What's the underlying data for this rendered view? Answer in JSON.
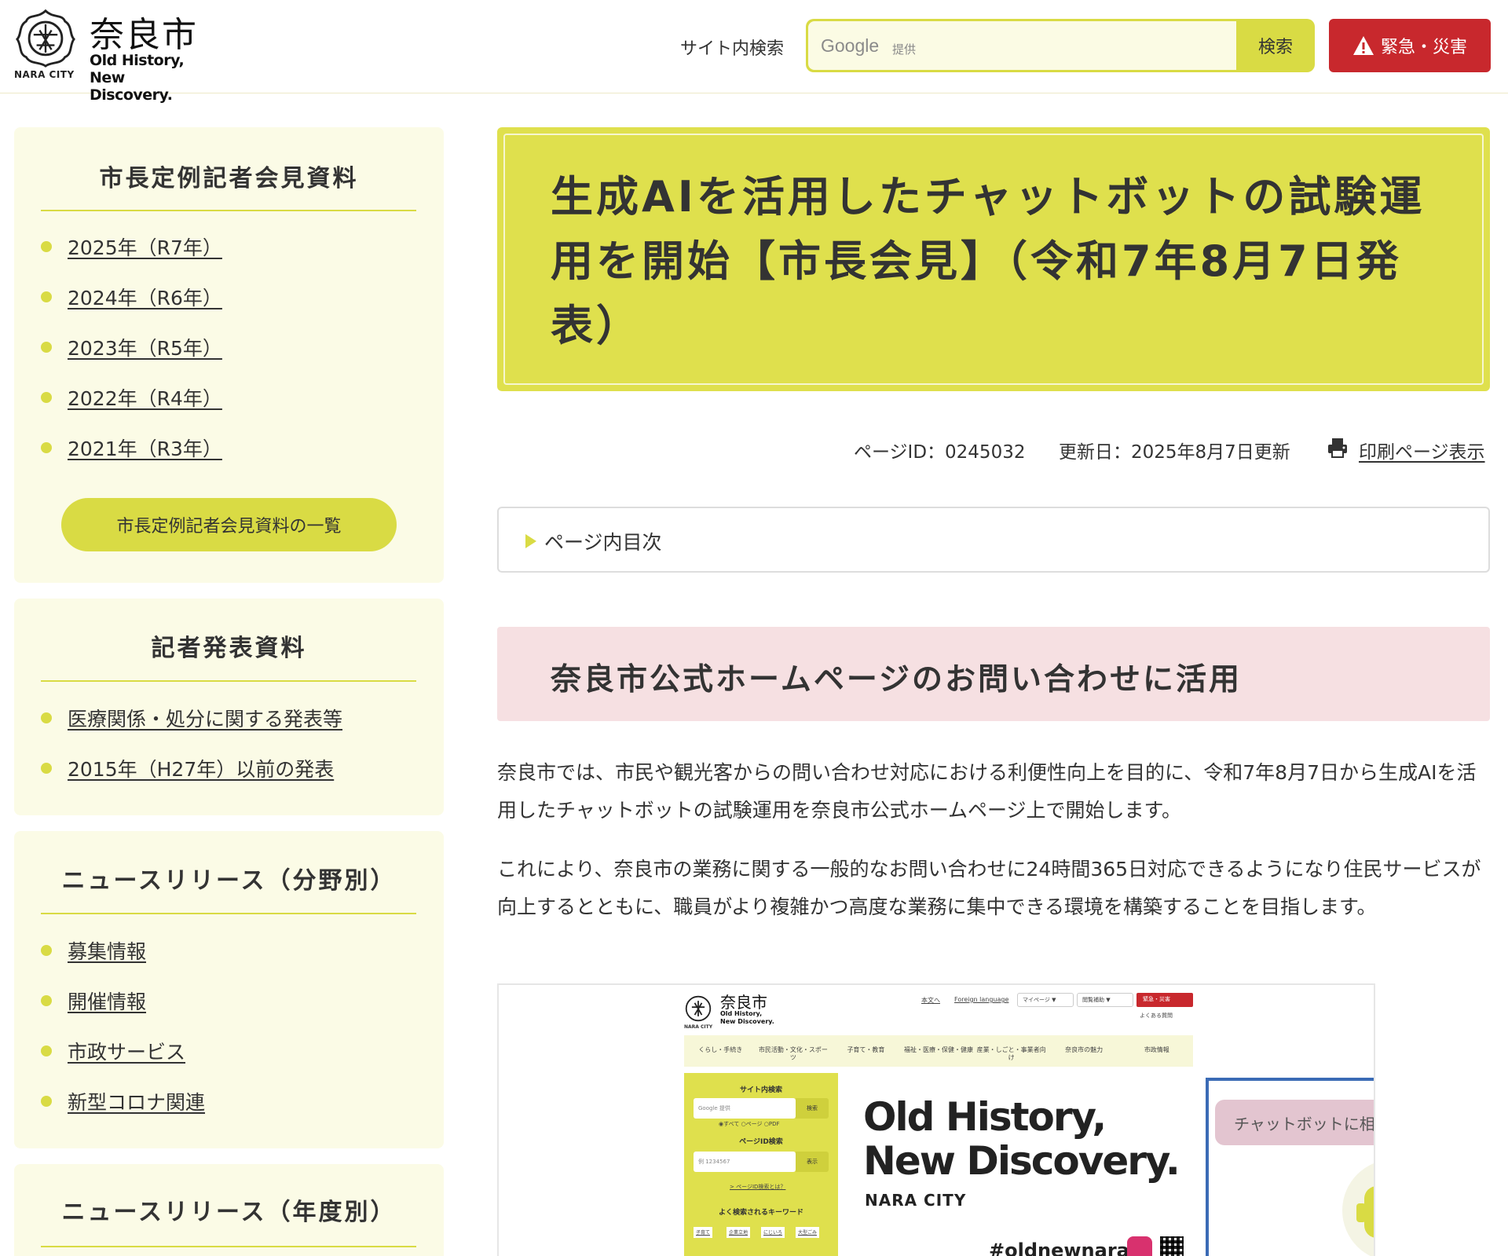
{
  "header": {
    "logo": {
      "name": "奈良市",
      "tagline_line1": "Old History,",
      "tagline_line2": "New Discovery.",
      "city_en": "NARA CITY"
    },
    "search": {
      "label": "サイト内検索",
      "provider": "Google",
      "provider_sub": "提供",
      "button": "検索"
    },
    "emergency_button": "緊急・災害",
    "icons": [
      "city-seal-icon",
      "warning-icon"
    ]
  },
  "sidebar": {
    "sections": [
      {
        "title": "市長定例記者会見資料",
        "items": [
          "2025年（R7年）",
          "2024年（R6年）",
          "2023年（R5年）",
          "2022年（R4年）",
          "2021年（R3年）"
        ],
        "button": "市長定例記者会見資料の一覧"
      },
      {
        "title": "記者発表資料",
        "items": [
          "医療関係・処分に関する発表等",
          "2015年（H27年）以前の発表"
        ]
      },
      {
        "title": "ニュースリリース（分野別）",
        "items": [
          "募集情報",
          "開催情報",
          "市政サービス",
          "新型コロナ関連"
        ]
      },
      {
        "title": "ニュースリリース（年度別）",
        "items": []
      }
    ]
  },
  "main": {
    "title": "生成AIを活用したチャットボットの試験運用を開始【市長会見】（令和7年8月7日発表）",
    "page_id": "ページID：0245032",
    "updated": "更新日：2025年8月7日更新",
    "print_link": "印刷ページ表示",
    "toc_label": "ページ内目次",
    "section_heading": "奈良市公式ホームページのお問い合わせに活用",
    "paragraphs": [
      "奈良市では、市民や観光客からの問い合わせ対応における利便性向上を目的に、令和7年8月7日から生成AIを活用したチャットボットの試験運用を奈良市公式ホームページ上で開始します。",
      "これにより、奈良市の業務に関する一般的なお問い合わせに24時間365日対応できるようになり住民サービスが向上するとともに、職員がより複雑かつ高度な業務に集中できる環境を構築することを目指します。"
    ]
  },
  "screenshot": {
    "logo_name": "奈良市",
    "tagline_line1": "Old History,",
    "tagline_line2": "New Discovery.",
    "city_en": "NARA CITY",
    "top_links": [
      "本文へ",
      "Foreign language"
    ],
    "selects": [
      "マイページ ▼",
      "閲覧補助 ▼"
    ],
    "emergency": "緊急・災害",
    "faq": "よくある質問",
    "nav": [
      "くらし・手続き",
      "市民活動・文化・スポーツ",
      "子育て・教育",
      "福祉・医療・保健・健康",
      "産業・しごと・事業者向け",
      "奈良市の魅力",
      "市政情報"
    ],
    "site_search_title": "サイト内検索",
    "search_placeholder": "Google 提供",
    "search_button": "検索",
    "radios": "◉すべて ○ページ ○PDF",
    "page_id_title": "ページID検索",
    "page_id_placeholder": "例 1234567",
    "page_id_button": "表示",
    "page_id_help": "> ページID検索とは？",
    "keywords_title": "よく検索されるキーワード",
    "keywords": [
      "子育て",
      "企業立地",
      "にじいろ",
      "大型ごみ"
    ],
    "hero_line1": "Old History,",
    "hero_line2": "New Discovery.",
    "hero_city": "NARA CITY",
    "hashtag": "#oldnewnara",
    "chat_prompt": "チャットボットに相談する。"
  },
  "colors": {
    "accent": "#d9db44",
    "accent_light": "#fbfbe6",
    "title_bg": "#dfe04d",
    "heading_pink": "#f6e0e2",
    "emergency_red": "#c8282d",
    "chat_border": "#3b6bb5"
  }
}
